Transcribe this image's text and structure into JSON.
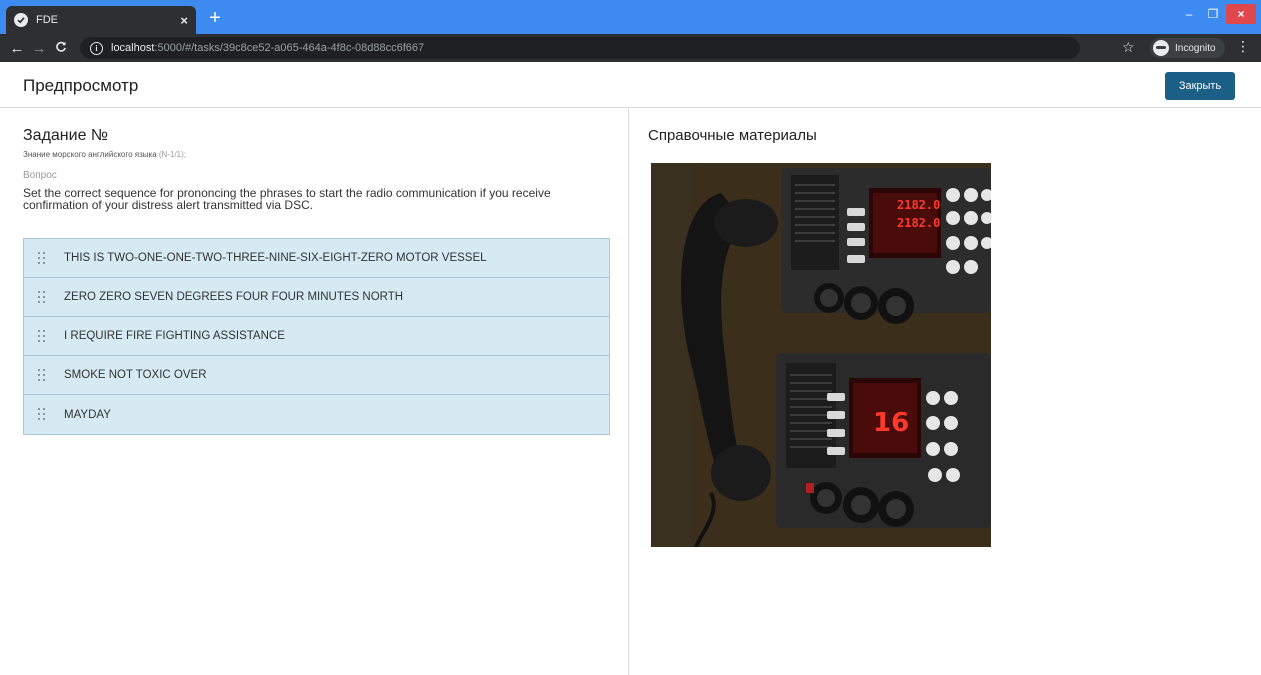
{
  "browser": {
    "tab_title": "FDE",
    "tab_close": "×",
    "new_tab": "+",
    "url_host": "localhost",
    "url_path": ":5000/#/tasks/39c8ce52-a065-464a-4f8c-08d88cc6f667",
    "profile_label": "Incognito",
    "icons": [
      "favicon-check-icon",
      "back-arrow-icon",
      "forward-arrow-icon",
      "reload-icon",
      "info-icon",
      "star-icon",
      "incognito-icon",
      "kebab-menu-icon"
    ]
  },
  "header": {
    "title": "Предпросмотр",
    "close_label": "Закрыть"
  },
  "task": {
    "title": "Задание №",
    "subject": "Знание морского английского языка",
    "code": "(N-1/1);",
    "question_label": "Вопрос",
    "question_text": "Set the correct sequence for prononcing the phrases to start the radio communication if you receive confirmation of your distress alert transmitted via DSC.",
    "answers": [
      "THIS IS TWO-ONE-ONE-TWO-THREE-NINE-SIX-EIGHT-ZERO MOTOR VESSEL",
      "ZERO ZERO SEVEN DEGREES FOUR FOUR MINUTES NORTH",
      "I REQUIRE FIRE FIGHTING ASSISTANCE",
      "SMOKE NOT TOXIC OVER",
      "MAYDAY"
    ]
  },
  "reference": {
    "title": "Справочные материалы"
  },
  "colors": {
    "tabbar": "#3d8bf0",
    "chrome_dark": "#2d2f33",
    "primary_button": "#1b5e86",
    "answer_bg": "#d6eaf3",
    "answer_border": "#a9c9d8"
  }
}
